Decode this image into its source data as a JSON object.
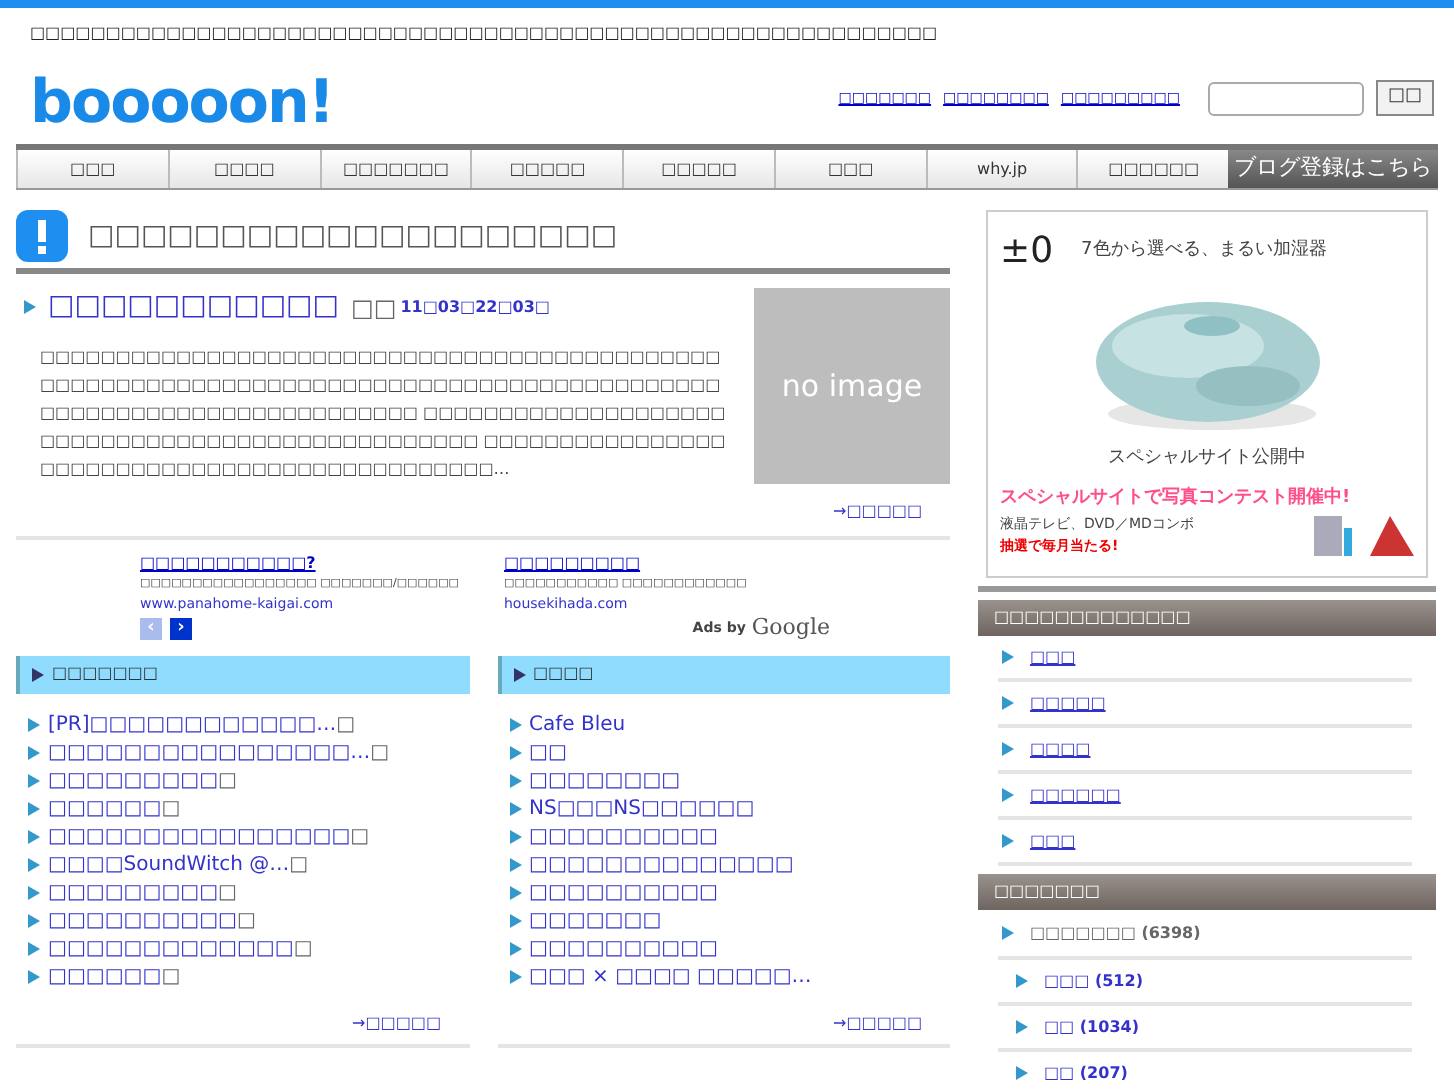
{
  "tagline": "□□□□□□□□□□□□□□□□□□□□□□□□□□□□□□□□□□□□□□□□□□□□□□□□□□□□□□□□□□□□",
  "logo": "booooon!",
  "header_links": [
    "□□□□□□□",
    "□□□□□□□□",
    "□□□□□□□□□"
  ],
  "search": {
    "button": "□□"
  },
  "nav": [
    {
      "label": "□□□",
      "kind": "tab"
    },
    {
      "label": "□□□□",
      "kind": "tab"
    },
    {
      "label": "□□□□□□□",
      "kind": "tab"
    },
    {
      "label": "□□□□□",
      "kind": "tab"
    },
    {
      "label": "□□□□□",
      "kind": "tab"
    },
    {
      "label": "□□□",
      "kind": "tab"
    },
    {
      "label": "why.jp",
      "kind": "tab"
    },
    {
      "label": "□□□□□□",
      "kind": "tab"
    },
    {
      "label": "ブログ登録はこちら",
      "kind": "cta"
    }
  ],
  "section_title": "□□□□□□□□□□□□□□□□□□□□",
  "article": {
    "title": "□□□□□□□□□□□",
    "author": "□□",
    "date": "11□03□22□03□",
    "body": "□□□□□□□□□□□□□□□□□□□□□□□□□□□□□□□□□□□□□□□□□□□□□□□□□□□□□□□□□□□□□□□□□□□□□□□□□□□□□□□□□□□□□□□□□□□□□□□□□□□□□□□□□□□□□□□□□□□ □□□□□□□□□□□□□□□□□□□□□□□□□□□□□□□□□□□□□□□□□□□□□□□□□ □□□□□□□□□□□□□□□□□□□□□□□□□□□□□□□□□□□□□□□□□□□□□□…",
    "no_image": "no image",
    "more": "→□□□□□"
  },
  "ads": [
    {
      "title": "□□□□□□□□□□□?",
      "description": "□□□□□□□□□□□□□□□□□ □□□□□□□/□□□□□□",
      "url": "www.panahome-kaigai.com"
    },
    {
      "title": "□□□□□□□□□",
      "description": "□□□□□□□□□□□ □□□□□□□□□□□□",
      "url": "housekihada.com"
    }
  ],
  "ad_pager": [
    {
      "label": "‹",
      "disabled": true
    },
    {
      "label": "›",
      "disabled": false
    }
  ],
  "ads_by": "Ads by",
  "ads_brand": "Google",
  "lists": [
    {
      "title": "□□□□□□□",
      "items": [
        {
          "text": "[PR]□□□□□□□□□□□□…",
          "note": "□"
        },
        {
          "text": "□□□□□□□□□□□□□□□□…",
          "note": "□"
        },
        {
          "text": "□□□□□□□□□",
          "note": "□"
        },
        {
          "text": "□□□□□□",
          "note": "□"
        },
        {
          "text": "□□□□□□□□□□□□□□□□",
          "note": "□"
        },
        {
          "text": "□□□□SoundWitch @…",
          "note": "□"
        },
        {
          "text": "□□□□□□□□□",
          "note": "□"
        },
        {
          "text": "□□□□□□□□□□",
          "note": "□"
        },
        {
          "text": "□□□□□□□□□□□□□",
          "note": "□"
        },
        {
          "text": "□□□□□□",
          "note": "□"
        }
      ],
      "more": "→□□□□□"
    },
    {
      "title": "□□□□",
      "items": [
        {
          "text": "Cafe Bleu"
        },
        {
          "text": "□□"
        },
        {
          "text": "□□□□□□□□"
        },
        {
          "text": "NS□□□NS□□□□□□"
        },
        {
          "text": "□□□□□□□□□□"
        },
        {
          "text": "□□□□□□□□□□□□□□"
        },
        {
          "text": "□□□□□□□□□□"
        },
        {
          "text": "□□□□□□□"
        },
        {
          "text": "□□□□□□□□□□"
        },
        {
          "text": "□□□ × □□□□ □□□□□…"
        }
      ],
      "more": "→□□□□□"
    }
  ],
  "banner": {
    "mark": "±0",
    "headline": "7色から選べる、まるい加湿器",
    "caption": "スペシャルサイト公開中",
    "contest": "スペシャルサイトで写真コンテスト開催中!",
    "prizes": "液晶テレビ、DVD／MDコンボ",
    "lottery": "抽選で毎月当たる!"
  },
  "sidebar": [
    {
      "title": "□□□□□□□□□□□□□",
      "items": [
        {
          "text": "□□□"
        },
        {
          "text": "□□□□□"
        },
        {
          "text": "□□□□"
        },
        {
          "text": "□□□□□□"
        },
        {
          "text": "□□□"
        }
      ]
    },
    {
      "title": "□□□□□□□",
      "items": [
        {
          "text": "□□□□□□□ (6398)",
          "children": [
            {
              "text": "□□□ (512)"
            },
            {
              "text": "□□ (1034)"
            },
            {
              "text": "□□ (207)"
            }
          ]
        }
      ]
    }
  ]
}
